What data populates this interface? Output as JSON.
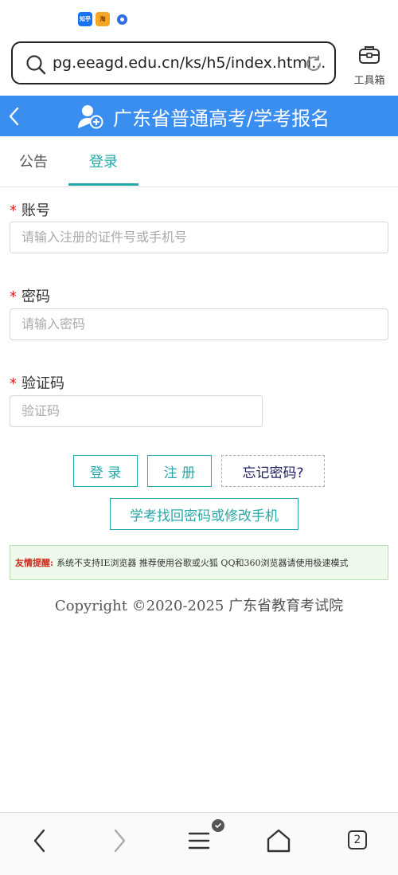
{
  "status_bar": {
    "notifications": [
      {
        "name": "zhihu-app-icon",
        "label": "知乎"
      },
      {
        "name": "taobao-app-icon",
        "label": "淘"
      },
      {
        "name": "browser-app-icon",
        "label": ""
      }
    ]
  },
  "browser": {
    "url": "pg.eeagd.edu.cn/ks/h5/index.html...",
    "toolbox_label": "工具箱"
  },
  "header": {
    "title": "广东省普通高考/学考报名"
  },
  "tabs": [
    {
      "label": "公告",
      "active": false
    },
    {
      "label": "登录",
      "active": true
    }
  ],
  "form": {
    "account": {
      "label": "账号",
      "required": "*",
      "placeholder": "请输入注册的证件号或手机号"
    },
    "password": {
      "label": "密码",
      "required": "*",
      "placeholder": "请输入密码"
    },
    "captcha": {
      "label": "验证码",
      "required": "*",
      "placeholder": "验证码"
    }
  },
  "buttons": {
    "login": "登 录",
    "register": "注 册",
    "forgot": "忘记密码?",
    "recover": "学考找回密码或修改手机"
  },
  "tip": {
    "title": "友情提醒:",
    "text": "系统不支持IE浏览器 推荐使用谷歌或火狐 QQ和360浏览器请使用极速模式"
  },
  "copyright": "Copyright ©2020-2025 广东省教育考试院",
  "bottom_nav": {
    "tab_count": "2"
  },
  "colors": {
    "header_bg": "#3a8ef0",
    "accent_teal": "#26a8a8",
    "required_red": "#e02020"
  }
}
